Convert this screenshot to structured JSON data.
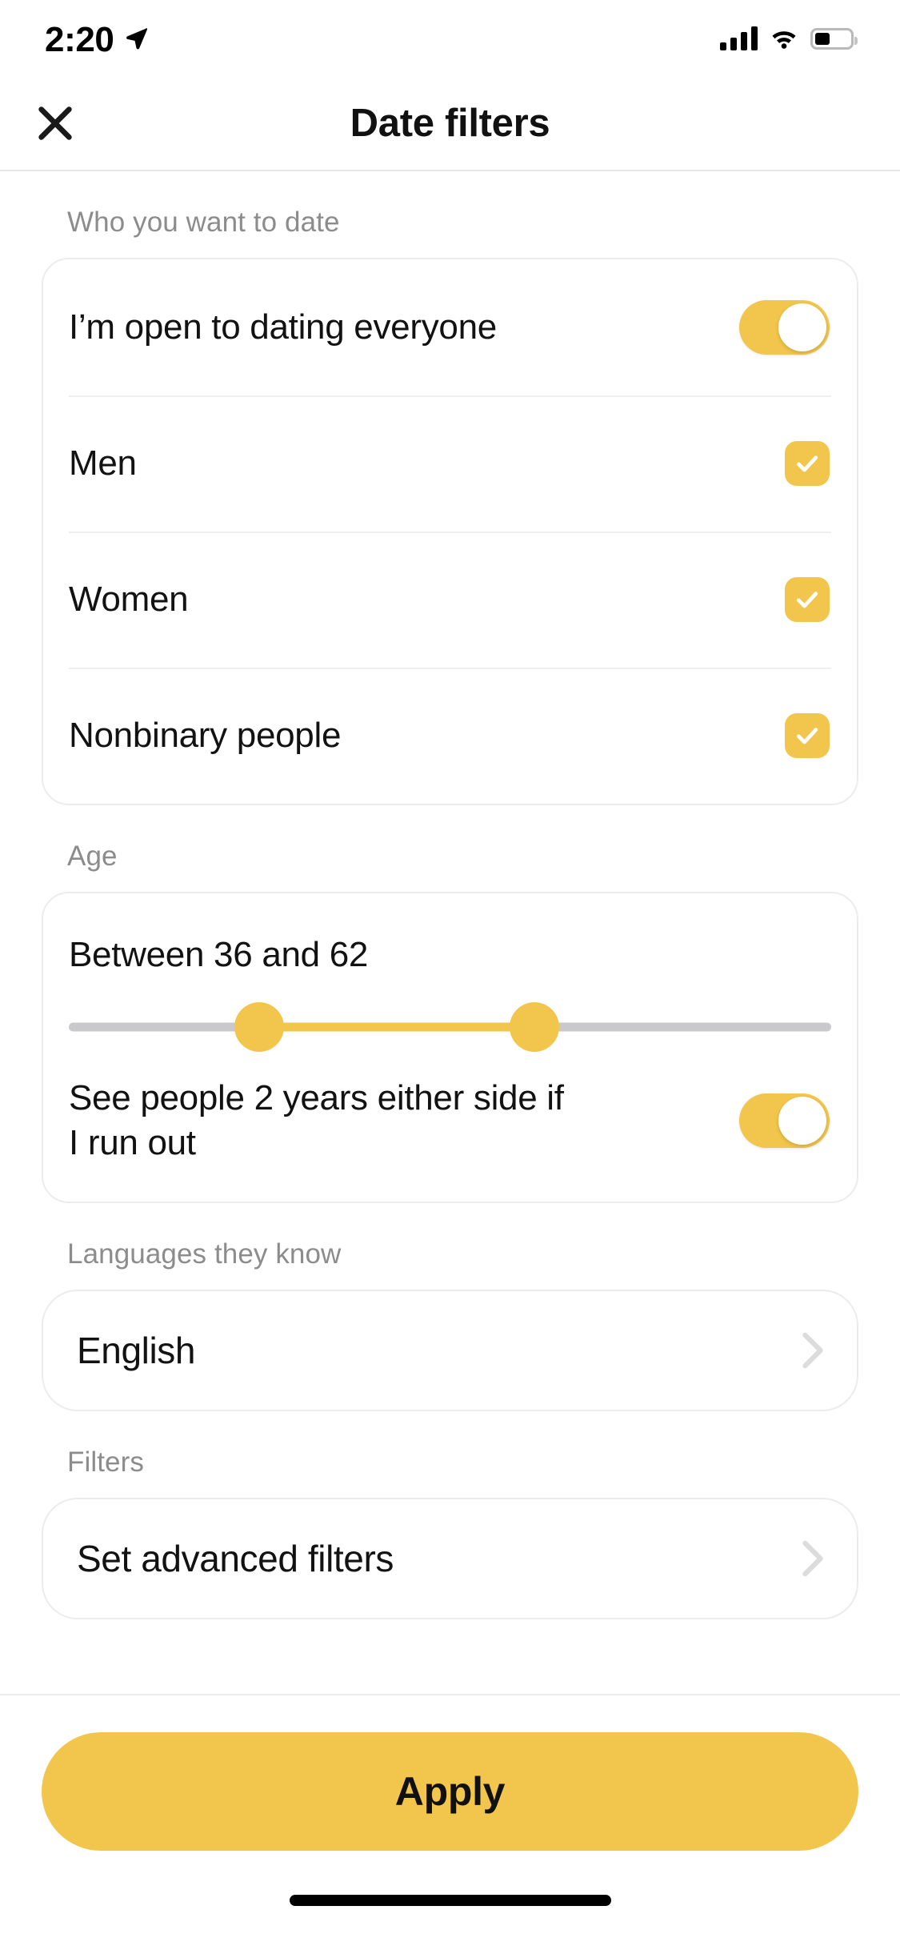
{
  "status_bar": {
    "time": "2:20",
    "location_icon": "location-arrow-icon",
    "signal_icon": "cellular-signal-icon",
    "wifi_icon": "wifi-icon",
    "battery_icon": "battery-icon",
    "battery_level_percent": 42
  },
  "header": {
    "title": "Date filters",
    "close_icon": "close-x-icon"
  },
  "sections": {
    "who": {
      "label": "Who you want to date",
      "rows": [
        {
          "label": "I’m open to dating everyone",
          "control": "toggle",
          "value": "on"
        },
        {
          "label": "Men",
          "control": "checkbox",
          "value": "checked"
        },
        {
          "label": "Women",
          "control": "checkbox",
          "value": "checked"
        },
        {
          "label": "Nonbinary people",
          "control": "checkbox",
          "value": "checked"
        }
      ]
    },
    "age": {
      "label": "Age",
      "value_text": "Between 36 and 62",
      "min_age": 36,
      "max_age": 62,
      "range_min": 18,
      "range_max": 90,
      "extra_row": {
        "label": "See people 2 years either side if I run out",
        "control": "toggle",
        "value": "on"
      }
    },
    "languages": {
      "label": "Languages they know",
      "value": "English",
      "chevron_icon": "chevron-right-icon"
    },
    "filters": {
      "label": "Filters",
      "value": "Set advanced filters",
      "chevron_icon": "chevron-right-icon"
    }
  },
  "footer": {
    "apply_label": "Apply"
  },
  "colors": {
    "accent": "#F2C64C",
    "text_primary": "#121212",
    "text_muted": "#8c8c8c",
    "border": "#ececec",
    "track": "#c9c9cc"
  }
}
